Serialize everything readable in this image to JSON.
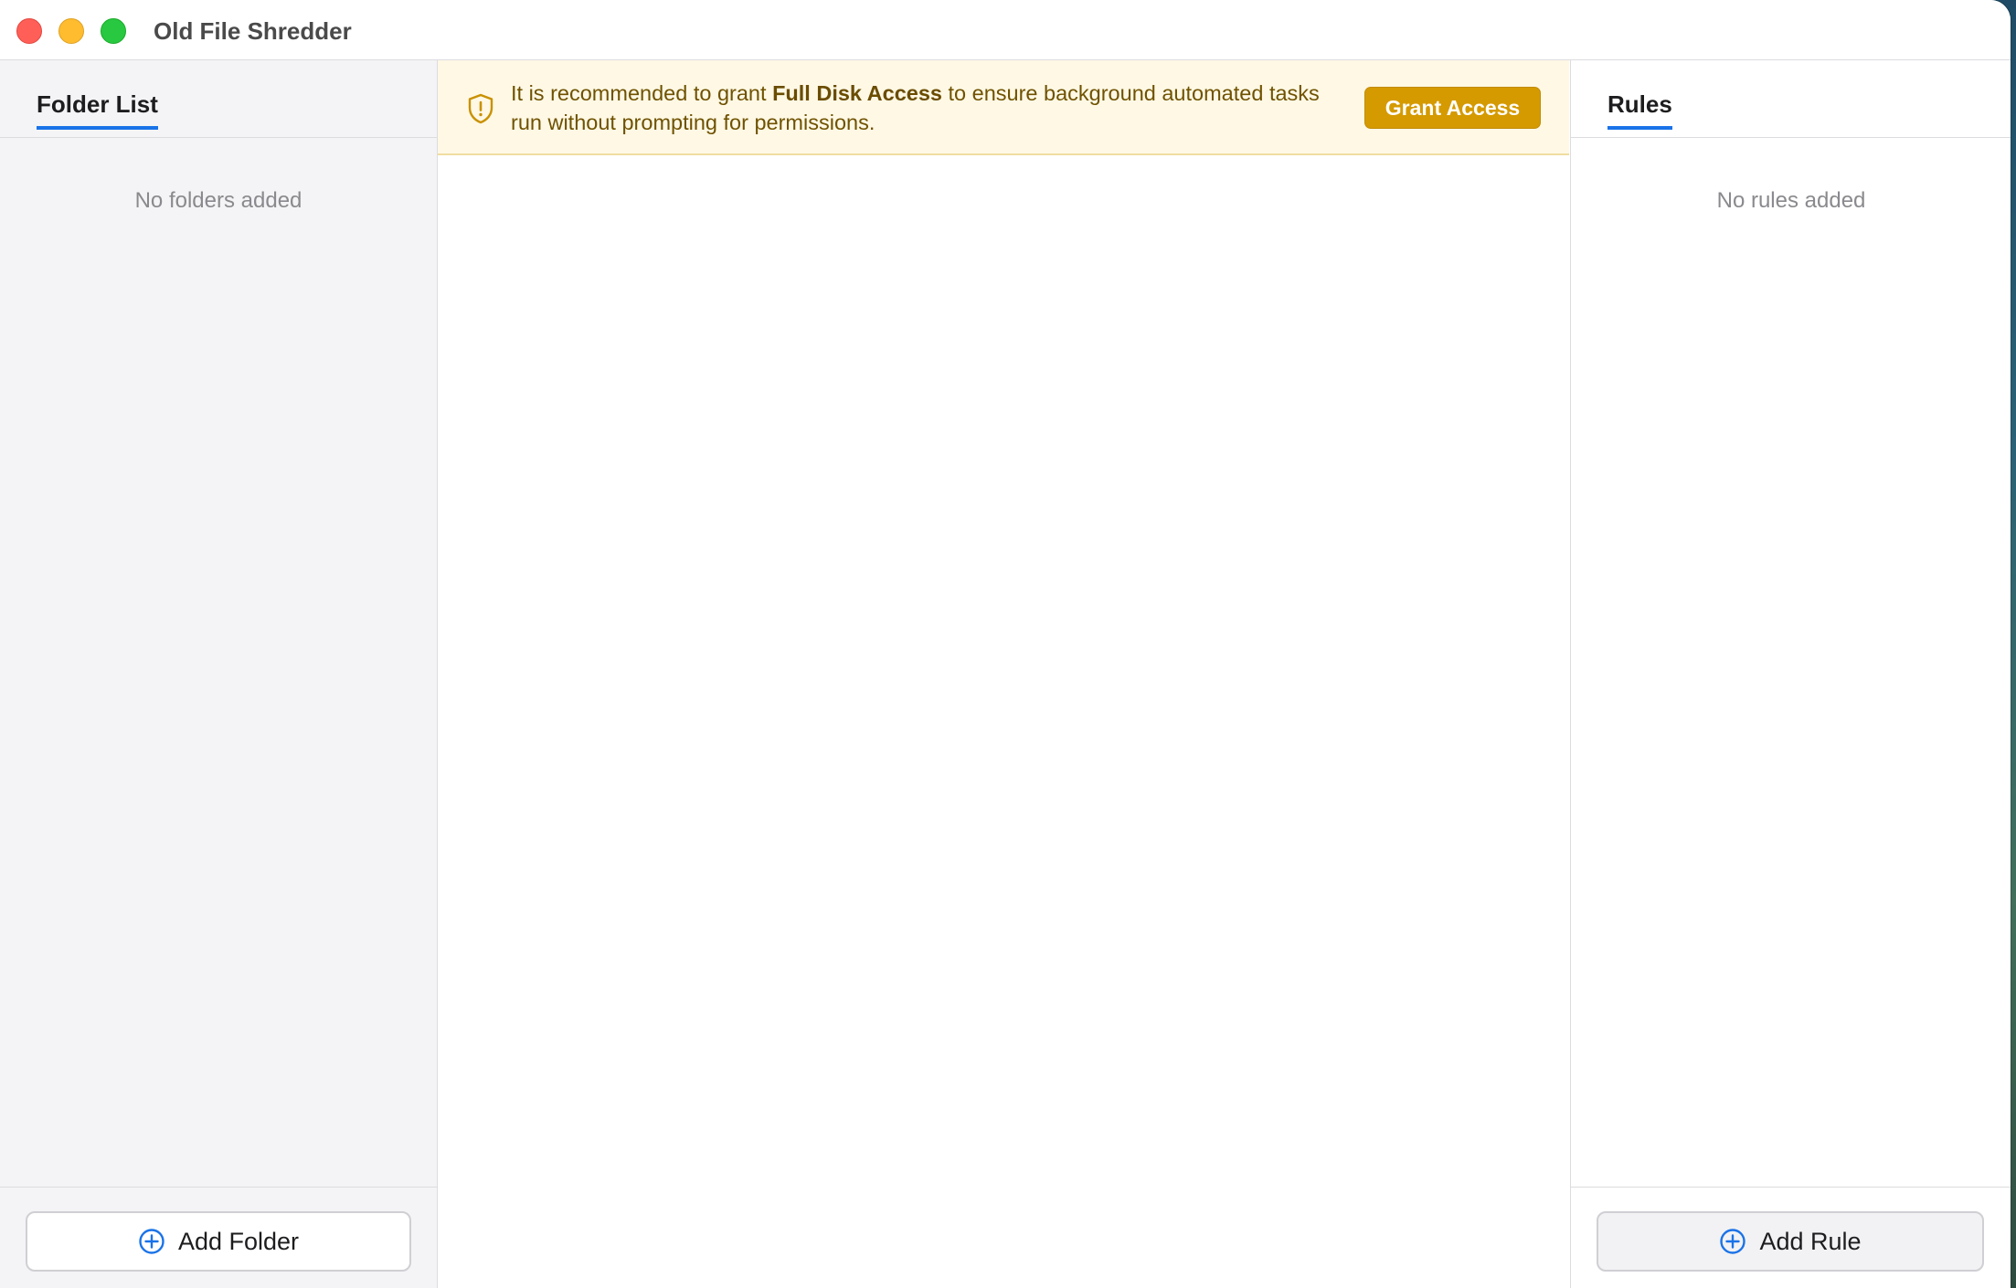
{
  "window": {
    "title": "Old File Shredder"
  },
  "folder_panel": {
    "tab_label": "Folder List",
    "empty_message": "No folders added",
    "add_button_label": "Add Folder",
    "add_button_icon": "plus-circle-icon"
  },
  "banner": {
    "message_before": "It is recommended to grant ",
    "message_bold": "Full Disk Access",
    "message_after": " to ensure background automated tasks run without prompting for permissions.",
    "icon": "shield-exclamation-icon",
    "button_label": "Grant Access"
  },
  "rules_panel": {
    "tab_label": "Rules",
    "empty_message": "No rules added",
    "add_button_label": "Add Rule",
    "add_button_icon": "plus-circle-icon"
  },
  "colors": {
    "accent": "#1a73e8",
    "warning_bg": "#fff8e5",
    "warning_button": "#d59a00"
  }
}
